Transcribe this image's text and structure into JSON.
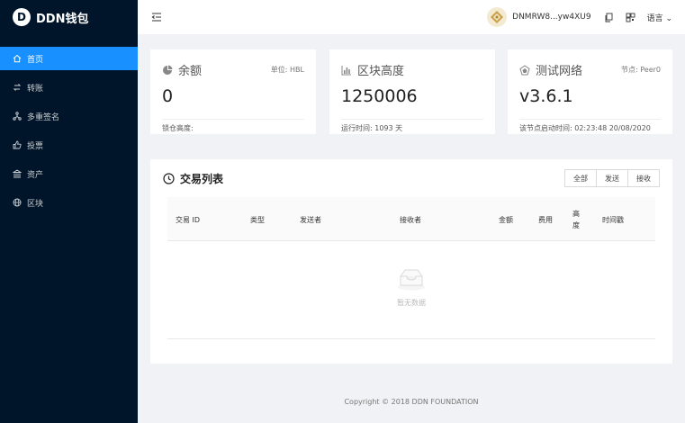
{
  "app": {
    "logo_letter": "D",
    "title": "DDN钱包"
  },
  "sidebar": {
    "items": [
      {
        "label": "首页",
        "icon": "home-icon"
      },
      {
        "label": "转账",
        "icon": "transfer-icon"
      },
      {
        "label": "多重签名",
        "icon": "multisig-icon"
      },
      {
        "label": "投票",
        "icon": "like-icon"
      },
      {
        "label": "资产",
        "icon": "bank-icon"
      },
      {
        "label": "区块",
        "icon": "globe-icon"
      }
    ]
  },
  "header": {
    "address": "DNMRW8...yw4XU9",
    "language": "语言"
  },
  "cards": {
    "balance": {
      "title": "余额",
      "extra": "单位: HBL",
      "value": "0",
      "foot": "锁仓高度:"
    },
    "height": {
      "title": "区块高度",
      "extra": "",
      "value": "1250006",
      "foot": "运行时间: 1093 天"
    },
    "network": {
      "title": "测试网络",
      "extra": "节点: Peer0",
      "value": "v3.6.1",
      "foot": "该节点启动时间: 02:23:48 20/08/2020"
    }
  },
  "transactions": {
    "title": "交易列表",
    "filters": [
      "全部",
      "发送",
      "接收"
    ],
    "columns": [
      "交易 ID",
      "类型",
      "发送者",
      "接收者",
      "金额",
      "费用",
      "高度",
      "时间戳"
    ],
    "empty_text": "暂无数据"
  },
  "footer": {
    "copyright": "Copyright © 2018 DDN FOUNDATION"
  },
  "colors": {
    "sidebar": "#001529",
    "accent": "#1890ff",
    "background": "#f0f2f5"
  }
}
